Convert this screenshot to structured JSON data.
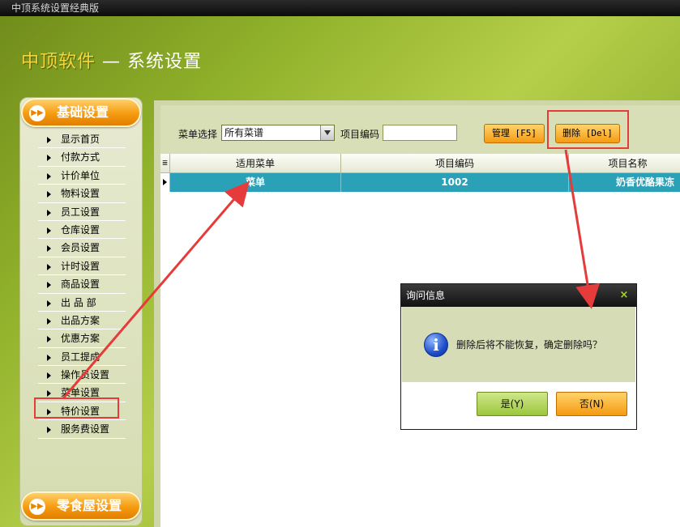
{
  "window": {
    "title": "中顶系统设置经典版"
  },
  "header": {
    "brand": "中顶软件",
    "separator": "—",
    "title": "系统设置"
  },
  "sidebar": {
    "section_basic": "基础设置",
    "section_snack": "零食屋设置",
    "items": [
      {
        "label": "显示首页"
      },
      {
        "label": "付款方式"
      },
      {
        "label": "计价单位"
      },
      {
        "label": "物料设置"
      },
      {
        "label": "员工设置"
      },
      {
        "label": "仓库设置"
      },
      {
        "label": "会员设置"
      },
      {
        "label": "计时设置"
      },
      {
        "label": "商品设置"
      },
      {
        "label": "出 品 部"
      },
      {
        "label": "出品方案"
      },
      {
        "label": "优惠方案"
      },
      {
        "label": "员工提成"
      },
      {
        "label": "操作员设置"
      },
      {
        "label": "菜单设置"
      },
      {
        "label": "特价设置"
      },
      {
        "label": "服务费设置"
      }
    ]
  },
  "toolbar": {
    "menu_label": "菜单选择",
    "menu_value": "所有菜谱",
    "code_label": "项目编码",
    "code_value": "",
    "manage_label": "管理 [F5]",
    "delete_label": "删除 [Del]"
  },
  "grid": {
    "headers": [
      "适用菜单",
      "项目编码",
      "项目名称"
    ],
    "rows": [
      [
        "菜单",
        "1002",
        "奶香优酪果冻"
      ]
    ]
  },
  "dialog": {
    "title": "询问信息",
    "close": "×",
    "message": "删除后将不能恢复，确定删除吗？",
    "yes": "是(Y)",
    "no": "否(N)"
  },
  "colors": {
    "accent_orange": "#f59a12",
    "selection_teal": "#2aa1b6",
    "annotation_red": "#e53b3b"
  }
}
